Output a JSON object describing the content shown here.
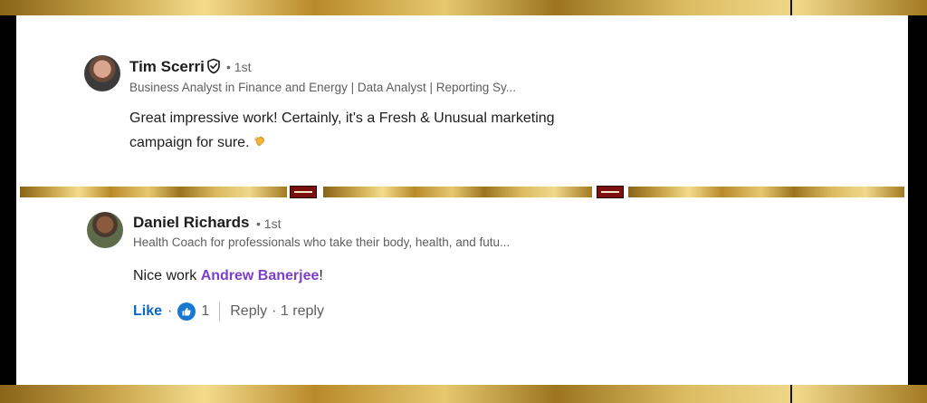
{
  "comments": [
    {
      "author": "Tim Scerri",
      "degree": "• 1st",
      "headline": "Business Analyst in Finance and Energy | Data Analyst | Reporting Sy...",
      "text_line1": "Great impressive work! Certainly, it's a Fresh & Unusual marketing",
      "text_line2": "campaign for sure.",
      "verified_icon": "shield-check-icon",
      "emoji_icon": "clapping-hands-icon"
    },
    {
      "author": "Daniel Richards",
      "degree": "• 1st",
      "headline": "Health Coach for professionals who take their body, health, and futu...",
      "text_before": "Nice work ",
      "mention": "Andrew Banerjee",
      "text_after": "!",
      "actions": {
        "like": "Like",
        "dot": "·",
        "reaction_count": "1",
        "reply": "Reply",
        "reply_count": "· 1 reply"
      },
      "reaction_icon": "thumbs-up-icon"
    }
  ],
  "colors": {
    "accent_blue": "#0a66c2",
    "mention_purple": "#7b3fc8",
    "frame_gold": "#c9a44a"
  }
}
